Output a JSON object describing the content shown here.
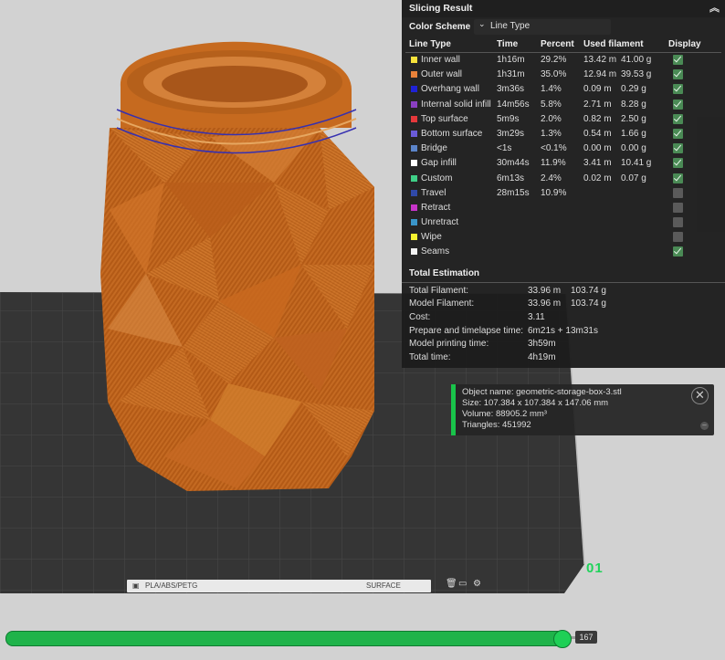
{
  "panel": {
    "title": "Slicing Result",
    "color_scheme_label": "Color Scheme",
    "color_scheme_value": "Line Type",
    "headers": {
      "line_type": "Line Type",
      "time": "Time",
      "percent": "Percent",
      "used_filament": "Used filament",
      "display": "Display"
    },
    "rows": [
      {
        "name": "Inner wall",
        "time": "1h16m",
        "percent": "29.2%",
        "meters": "13.42 m",
        "grams": "41.00 g",
        "color": "#f7e23b",
        "display": true
      },
      {
        "name": "Outer wall",
        "time": "1h31m",
        "percent": "35.0%",
        "meters": "12.94 m",
        "grams": "39.53 g",
        "color": "#e9823a",
        "display": true
      },
      {
        "name": "Overhang wall",
        "time": "3m36s",
        "percent": "1.4%",
        "meters": "0.09 m",
        "grams": "0.29 g",
        "color": "#1f22d6",
        "display": true
      },
      {
        "name": "Internal solid infill",
        "time": "14m56s",
        "percent": "5.8%",
        "meters": "2.71 m",
        "grams": "8.28 g",
        "color": "#8a3fc2",
        "display": true
      },
      {
        "name": "Top surface",
        "time": "5m9s",
        "percent": "2.0%",
        "meters": "0.82 m",
        "grams": "2.50 g",
        "color": "#e5383b",
        "display": true
      },
      {
        "name": "Bottom surface",
        "time": "3m29s",
        "percent": "1.3%",
        "meters": "0.54 m",
        "grams": "1.66 g",
        "color": "#6a5bd8",
        "display": true
      },
      {
        "name": "Bridge",
        "time": "<1s",
        "percent": "<0.1%",
        "meters": "0.00 m",
        "grams": "0.00 g",
        "color": "#5b84c9",
        "display": true
      },
      {
        "name": "Gap infill",
        "time": "30m44s",
        "percent": "11.9%",
        "meters": "3.41 m",
        "grams": "10.41 g",
        "color": "#ffffff",
        "display": true
      },
      {
        "name": "Custom",
        "time": "6m13s",
        "percent": "2.4%",
        "meters": "0.02 m",
        "grams": "0.07 g",
        "color": "#3fcf87",
        "display": true
      },
      {
        "name": "Travel",
        "time": "28m15s",
        "percent": "10.9%",
        "meters": "",
        "grams": "",
        "color": "#3049a8",
        "display": false
      },
      {
        "name": "Retract",
        "time": "",
        "percent": "",
        "meters": "",
        "grams": "",
        "color": "#c734c9",
        "display": false
      },
      {
        "name": "Unretract",
        "time": "",
        "percent": "",
        "meters": "",
        "grams": "",
        "color": "#3a95c9",
        "display": false
      },
      {
        "name": "Wipe",
        "time": "",
        "percent": "",
        "meters": "",
        "grams": "",
        "color": "#f5f230",
        "display": false
      },
      {
        "name": "Seams",
        "time": "",
        "percent": "",
        "meters": "",
        "grams": "",
        "color": "#f2f2f2",
        "display": true
      }
    ],
    "total_title": "Total Estimation",
    "totals": [
      {
        "label": "Total Filament:",
        "v1": "33.96 m",
        "v2": "103.74 g"
      },
      {
        "label": "Model Filament:",
        "v1": "33.96 m",
        "v2": "103.74 g"
      },
      {
        "label": "Cost:",
        "v1": "3.11",
        "v2": ""
      },
      {
        "label": "Prepare and timelapse time:",
        "v1": "6m21s + 13m31s",
        "v2": ""
      },
      {
        "label": "Model printing time:",
        "v1": "3h59m",
        "v2": ""
      },
      {
        "label": "Total time:",
        "v1": "4h19m",
        "v2": ""
      }
    ]
  },
  "object_info": {
    "name": "Object name: geometric-storage-box-3.stl",
    "size": "Size: 107.384 x 107.384 x 147.06 mm",
    "volume": "Volume: 88905.2 mm³",
    "triangles": "Triangles: 451992"
  },
  "plate": {
    "number": "01",
    "filament_label": "PLA/ABS/PETG",
    "surface_label": "SURFACE"
  },
  "layer_slider": {
    "value": "167",
    "fraction": 0.98
  },
  "colors": {
    "model": "#c96a1f",
    "accent": "#1fb34a",
    "plate": "#3a3a3a"
  }
}
